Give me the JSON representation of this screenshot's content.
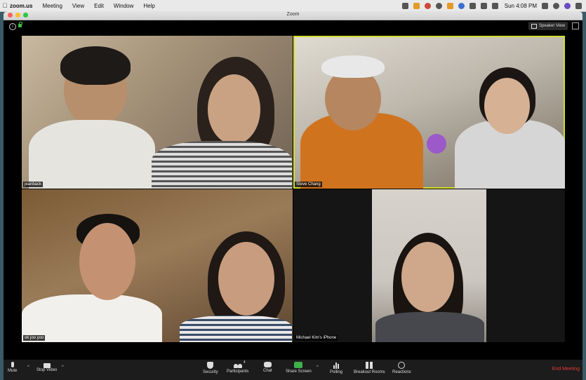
{
  "menubar": {
    "app_name": "zoom.us",
    "menus": [
      "Meeting",
      "View",
      "Edit",
      "Window",
      "Help"
    ],
    "clock": "Sun 4:08 PM"
  },
  "window": {
    "title": "Zoom",
    "speaker_view_label": "Speaker View"
  },
  "participants": [
    {
      "name": "jeanback",
      "active_speaker": false
    },
    {
      "name": "Steve Chang",
      "active_speaker": true
    },
    {
      "name": "ok joo yoo",
      "active_speaker": false
    },
    {
      "name": "Michael Kim's iPhone",
      "active_speaker": false
    }
  ],
  "toolbar": {
    "mute": "Mute",
    "stop_video": "Stop Video",
    "security": "Security",
    "participants": "Participants",
    "participants_count": "4",
    "chat": "Chat",
    "share_screen": "Share Screen",
    "polling": "Polling",
    "breakout_rooms": "Breakout Rooms",
    "reactions": "Reactions",
    "end_meeting": "End Meeting"
  },
  "colors": {
    "active_speaker_border": "#d2dd2c",
    "share_screen": "#3fb04a",
    "end_meeting": "#e53935"
  }
}
